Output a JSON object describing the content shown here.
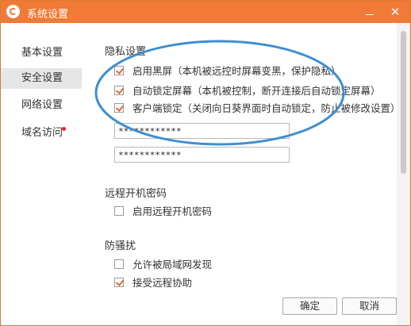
{
  "window": {
    "title": "系统设置",
    "minimize_glyph": "—",
    "close_glyph": "✕"
  },
  "colors": {
    "titlebar": "#f07a36",
    "check": "#e2683a",
    "annotation": "#3d8fd1",
    "badge": "#e8262d"
  },
  "icons": [
    "app-logo-icon",
    "minimize-icon",
    "close-icon",
    "notification-dot-icon"
  ],
  "sidebar": {
    "items": [
      {
        "label": "基本设置",
        "active": false
      },
      {
        "label": "安全设置",
        "active": true
      },
      {
        "label": "网络设置",
        "active": false
      },
      {
        "label": "域名访问",
        "active": false,
        "badge": true
      }
    ]
  },
  "privacy": {
    "title": "隐私设置",
    "options": [
      {
        "label": "启用黑屏（本机被远控时屏幕变黑，保护隐私）",
        "checked": true
      },
      {
        "label": "自动锁定屏幕（本机被控制，断开连接后自动锁定屏幕）",
        "checked": true
      },
      {
        "label": "客户端锁定（关闭向日葵界面时自动锁定，防止被修改设置）",
        "checked": true
      }
    ],
    "password1": "************",
    "password2": "************"
  },
  "remote_boot": {
    "title": "远程开机密码",
    "option": {
      "label": "启用远程开机密码",
      "checked": false
    }
  },
  "anti_harass": {
    "title": "防骚扰",
    "options": [
      {
        "label": "允许被局域网发现",
        "checked": false
      },
      {
        "label": "接受远程协助",
        "checked": true
      }
    ]
  },
  "buttons": {
    "ok": "确定",
    "cancel": "取消"
  }
}
